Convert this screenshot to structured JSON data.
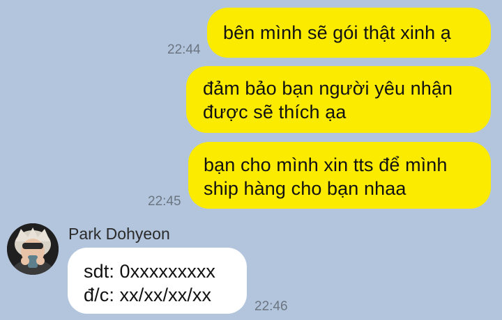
{
  "conversation": {
    "outgoing": [
      {
        "lines": [
          "bên mình sẽ gói thật xinh ạ"
        ],
        "time": "22:44"
      },
      {
        "lines": [
          "đảm bảo bạn người yêu nhận",
          "được sẽ thích ạa"
        ]
      },
      {
        "lines": [
          "bạn cho mình xin tts để mình",
          "ship hàng cho bạn nhaa"
        ],
        "time": "22:45"
      }
    ],
    "incoming": {
      "sender_name": "Park Dohyeon",
      "avatar_icon": "profile-photo",
      "lines": [
        "sdt: 0xxxxxxxxx",
        "đ/c: xx/xx/xx/xx"
      ],
      "time": "22:46"
    }
  },
  "colors": {
    "background": "#b3c5dc",
    "outgoing_bubble": "#fbeb00",
    "incoming_bubble": "#ffffff",
    "timestamp": "#6b7581"
  }
}
